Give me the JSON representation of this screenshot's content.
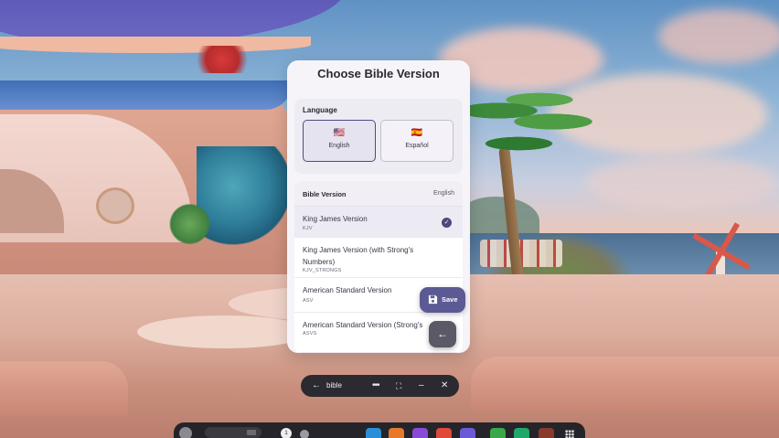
{
  "dialog": {
    "title": "Choose Bible Version",
    "language_section": {
      "label": "Language",
      "options": [
        {
          "flag": "🇺🇸",
          "name": "English",
          "selected": true
        },
        {
          "flag": "🇪🇸",
          "name": "Español",
          "selected": false
        }
      ]
    },
    "version_section": {
      "label": "Bible Version",
      "current_language": "English",
      "versions": [
        {
          "name": "King James Version",
          "code": "KJV",
          "selected": true
        },
        {
          "name": "King James Version (with Strong's Numbers)",
          "code": "KJV_STRONGS",
          "selected": false
        },
        {
          "name": "American Standard Version",
          "code": "ASV",
          "selected": false
        },
        {
          "name": "American Standard Version (Strong's",
          "code": "ASVS",
          "selected": false
        }
      ]
    },
    "save_label": "Save",
    "back_icon": "arrow-left-icon",
    "save_icon": "floppy-disk-icon",
    "check_icon": "checkmark-icon"
  },
  "window_bar": {
    "title": "bible",
    "back_icon": "arrow-left-icon",
    "more_icon": "more-dots-icon",
    "expand_icon": "expand-icon",
    "minimize_icon": "minimize-icon",
    "close_icon": "close-icon"
  },
  "taskbar": {
    "notification_count": "1",
    "apps": [
      {
        "icon": "app-blue-icon",
        "color": "#2a8fd8"
      },
      {
        "icon": "app-orange-icon",
        "color": "#e8782a"
      },
      {
        "icon": "app-purple-icon",
        "color": "#8a4ad8"
      },
      {
        "icon": "app-red-icon",
        "color": "#e0483a"
      },
      {
        "icon": "app-violet-icon",
        "color": "#6a5ad8"
      },
      {
        "icon": "app-green-icon",
        "color": "#3aa84a"
      },
      {
        "icon": "app-teal-icon",
        "color": "#1fa86a"
      },
      {
        "icon": "app-bible-icon",
        "color": "#8a3a2a"
      }
    ]
  },
  "colors": {
    "accent": "#5c5a94",
    "panel_bg": "#f6f4f9",
    "selected_row": "#ecebf4"
  }
}
